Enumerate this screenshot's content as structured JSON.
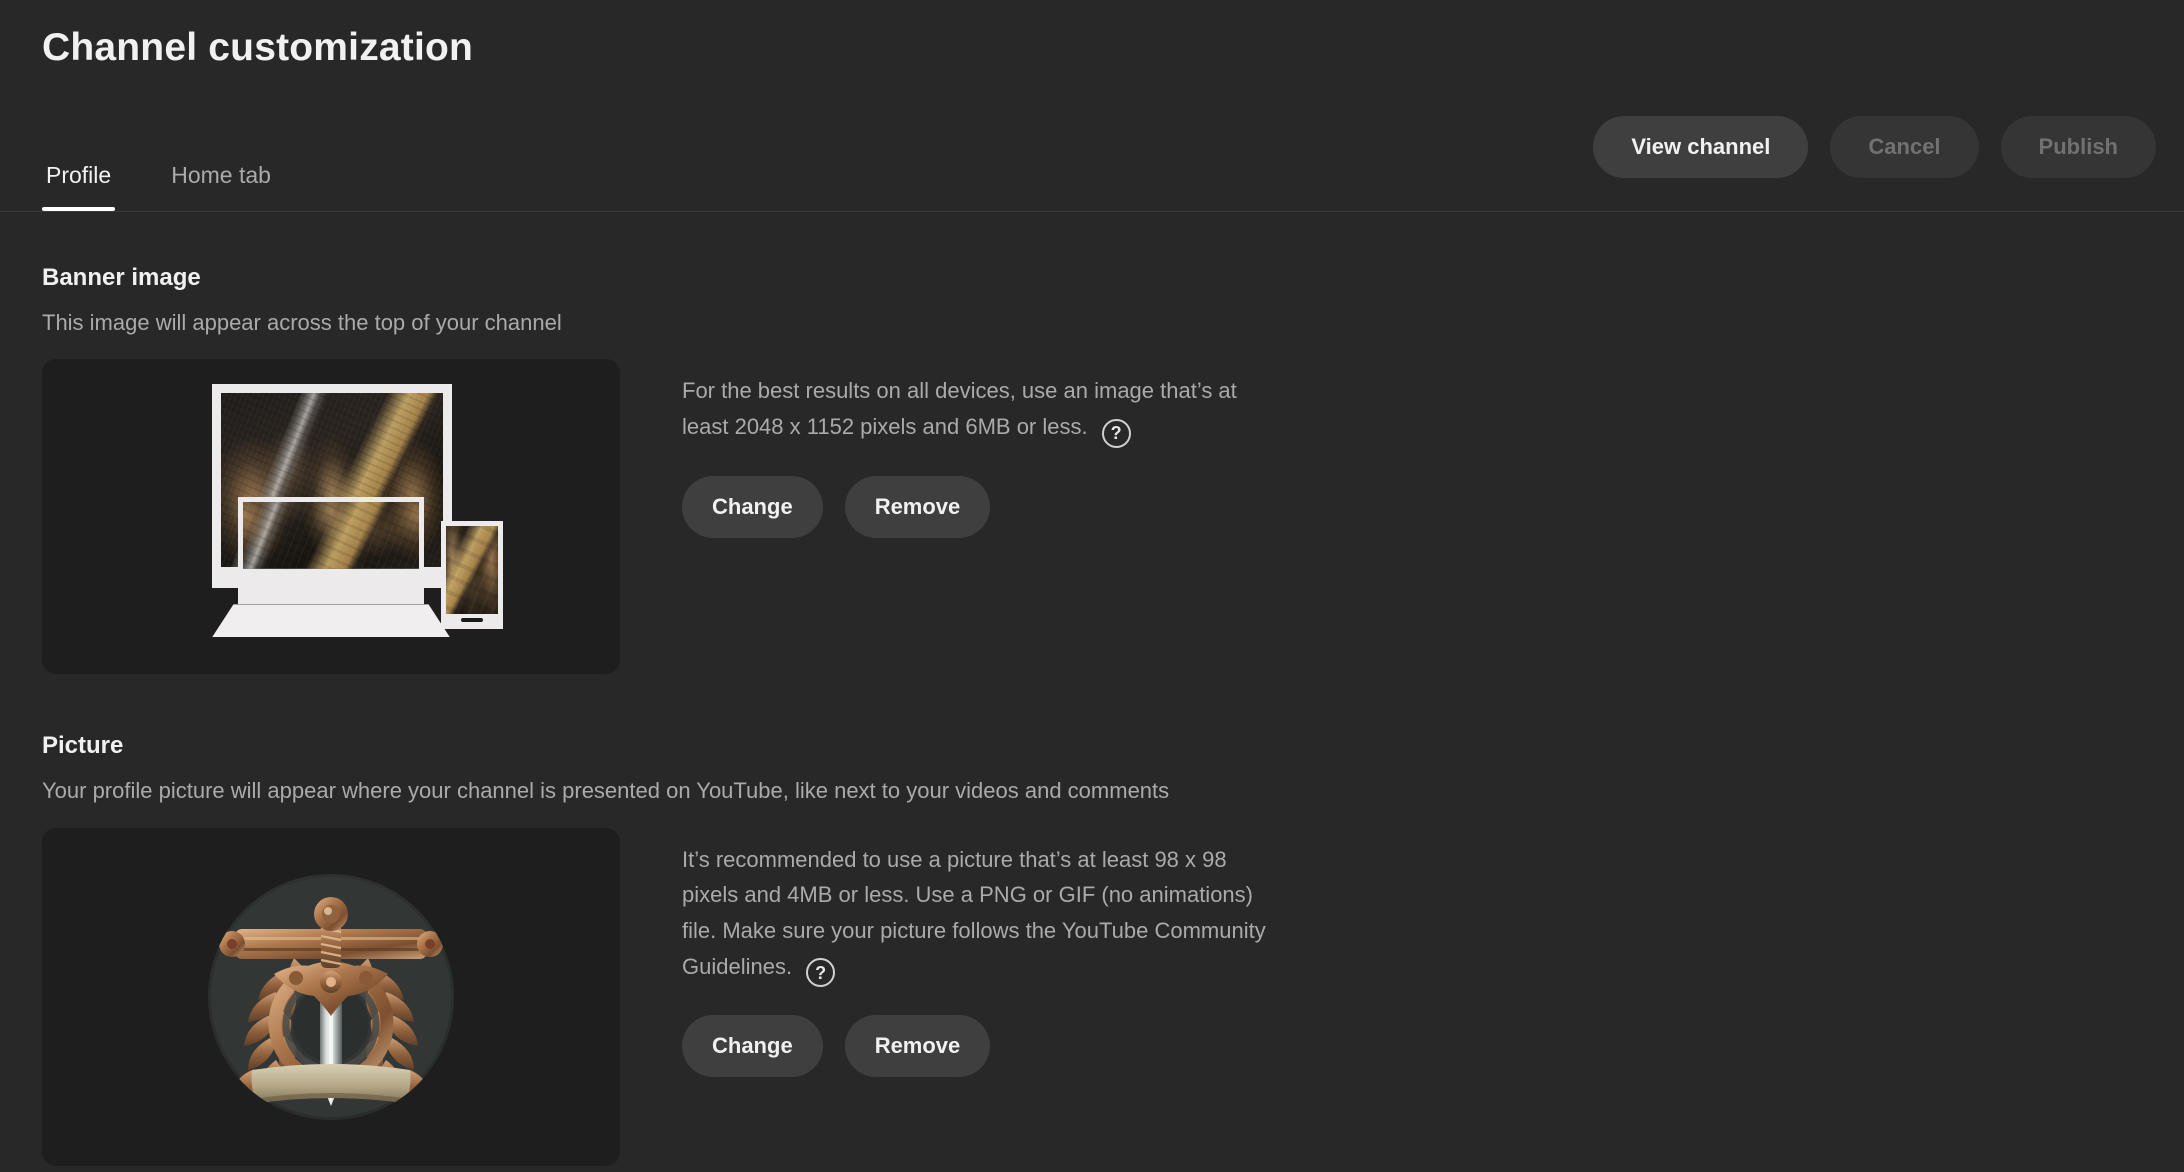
{
  "header": {
    "title": "Channel customization",
    "tabs": [
      {
        "label": "Profile",
        "active": true
      },
      {
        "label": "Home tab",
        "active": false
      }
    ],
    "actions": {
      "view_channel": "View channel",
      "cancel": "Cancel",
      "publish": "Publish"
    }
  },
  "banner": {
    "title": "Banner image",
    "subtitle": "This image will appear across the top of your channel",
    "info": "For the best results on all devices, use an image that’s at least 2048 x 1152 pixels and 6MB or less.",
    "help_glyph": "?",
    "change_label": "Change",
    "remove_label": "Remove"
  },
  "picture": {
    "title": "Picture",
    "subtitle": "Your profile picture will appear where your channel is presented on YouTube, like next to your videos and comments",
    "info": "It’s recommended to use a picture that’s at least 98 x 98 pixels and 4MB or less. Use a PNG or GIF (no animations) file. Make sure your picture follows the YouTube Community Guidelines.",
    "help_glyph": "?",
    "change_label": "Change",
    "remove_label": "Remove"
  },
  "colors": {
    "page_background": "#282828",
    "card_background": "#1e1e1e",
    "button_background": "#3f3f3f",
    "text_primary": "#f1f1f1",
    "text_secondary": "#aaaaaa",
    "text_disabled": "#717171",
    "accent_underline": "#ffffff",
    "banner_gold": "#c4a05c",
    "crest_bronze": "#b07a4e"
  }
}
